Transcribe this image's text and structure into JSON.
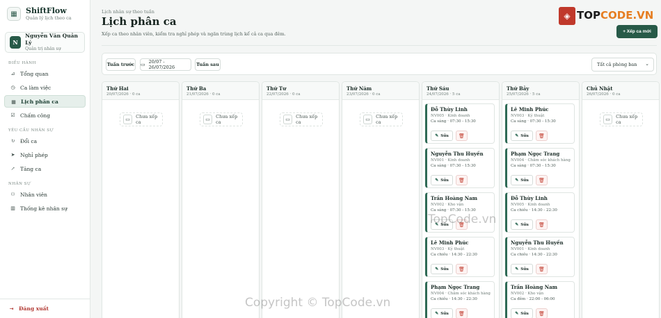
{
  "brand": {
    "name": "ShiftFlow",
    "subtitle": "Quản lý lịch theo ca",
    "logo_icon": "calendar-icon"
  },
  "user": {
    "initial": "N",
    "name": "Nguyễn Văn Quản Lý",
    "role": "Quản trị nhân sự"
  },
  "sidebar": {
    "sections": [
      {
        "label": "ĐIỀU HÀNH",
        "items": [
          {
            "label": "Tổng quan",
            "icon": "chart-icon",
            "glyph": "⊿"
          },
          {
            "label": "Ca làm việc",
            "icon": "clock-icon",
            "glyph": "◷"
          },
          {
            "label": "Lịch phân ca",
            "icon": "calendar-icon",
            "glyph": "▦",
            "active": true
          },
          {
            "label": "Chấm công",
            "icon": "check-icon",
            "glyph": "☑"
          }
        ]
      },
      {
        "label": "YÊU CẦU NHÂN SỰ",
        "items": [
          {
            "label": "Đổi ca",
            "icon": "swap-icon",
            "glyph": "↻"
          },
          {
            "label": "Nghỉ phép",
            "icon": "send-icon",
            "glyph": "➤"
          },
          {
            "label": "Tăng ca",
            "icon": "trend-icon",
            "glyph": "↗"
          }
        ]
      },
      {
        "label": "NHÂN SỰ",
        "items": [
          {
            "label": "Nhân viên",
            "icon": "users-icon",
            "glyph": "⚇"
          },
          {
            "label": "Thống kê nhân sự",
            "icon": "bar-chart-icon",
            "glyph": "▥"
          }
        ]
      }
    ],
    "logout_label": "Đăng xuất"
  },
  "header": {
    "breadcrumb": "Lịch nhân sự theo tuần",
    "title": "Lịch phân ca",
    "description": "Xếp ca theo nhân viên, kiểm tra nghỉ phép và ngăn trùng lịch kể cả ca qua đêm.",
    "add_button": "+ Xếp ca mới"
  },
  "toolbar": {
    "prev": "Tuần trước",
    "range": "20/07 - 26/07/2026",
    "next": "Tuần sau",
    "dept_select": "Tất cả phòng ban"
  },
  "labels": {
    "empty": "Chưa xếp ca",
    "edit": "Sửa"
  },
  "days": [
    {
      "day": "Thứ Hai",
      "meta": "20/07/2026 · 0 ca",
      "cards": []
    },
    {
      "day": "Thứ Ba",
      "meta": "21/07/2026 · 0 ca",
      "cards": []
    },
    {
      "day": "Thứ Tư",
      "meta": "22/07/2026 · 0 ca",
      "cards": []
    },
    {
      "day": "Thứ Năm",
      "meta": "23/07/2026 · 0 ca",
      "cards": []
    },
    {
      "day": "Thứ Sáu",
      "meta": "24/07/2026 · 5 ca",
      "cards": [
        {
          "name": "Đỗ Thùy Linh",
          "sub": "NV005 · Kinh doanh",
          "shift": "Ca sáng · 07:30 - 15:30"
        },
        {
          "name": "Nguyễn Thu Huyền",
          "sub": "NV001 · Kinh doanh",
          "shift": "Ca sáng · 07:30 - 15:30"
        },
        {
          "name": "Trần Hoàng Nam",
          "sub": "NV002 · Kho vận",
          "shift": "Ca sáng · 07:30 - 15:30"
        },
        {
          "name": "Lê Minh Phúc",
          "sub": "NV003 · Kỹ thuật",
          "shift": "Ca chiều · 14:30 - 22:30"
        },
        {
          "name": "Phạm Ngọc Trang",
          "sub": "NV004 · Chăm sóc khách hàng",
          "shift": "Ca chiều · 14:30 - 22:30"
        }
      ]
    },
    {
      "day": "Thứ Bảy",
      "meta": "25/07/2026 · 5 ca",
      "cards": [
        {
          "name": "Lê Minh Phúc",
          "sub": "NV003 · Kỹ thuật",
          "shift": "Ca sáng · 07:30 - 15:30"
        },
        {
          "name": "Phạm Ngọc Trang",
          "sub": "NV004 · Chăm sóc khách hàng",
          "shift": "Ca sáng · 07:30 - 15:30"
        },
        {
          "name": "Đỗ Thùy Linh",
          "sub": "NV005 · Kinh doanh",
          "shift": "Ca chiều · 14:30 - 22:30"
        },
        {
          "name": "Nguyễn Thu Huyền",
          "sub": "NV001 · Kinh doanh",
          "shift": "Ca chiều · 14:30 - 22:30"
        },
        {
          "name": "Trần Hoàng Nam",
          "sub": "NV002 · Kho vận",
          "shift": "Ca đêm · 22:00 - 06:00"
        }
      ]
    },
    {
      "day": "Chủ Nhật",
      "meta": "26/07/2026 · 0 ca",
      "cards": []
    }
  ],
  "watermark": {
    "logo_letters": "TOP",
    "logo_accent": "CODE.VN",
    "mid": "TopCode.vn",
    "bottom": "Copyright © TopCode.vn"
  },
  "colors": {
    "primary": "#275a48",
    "danger": "#c0392b",
    "accent": "#e67e22"
  }
}
